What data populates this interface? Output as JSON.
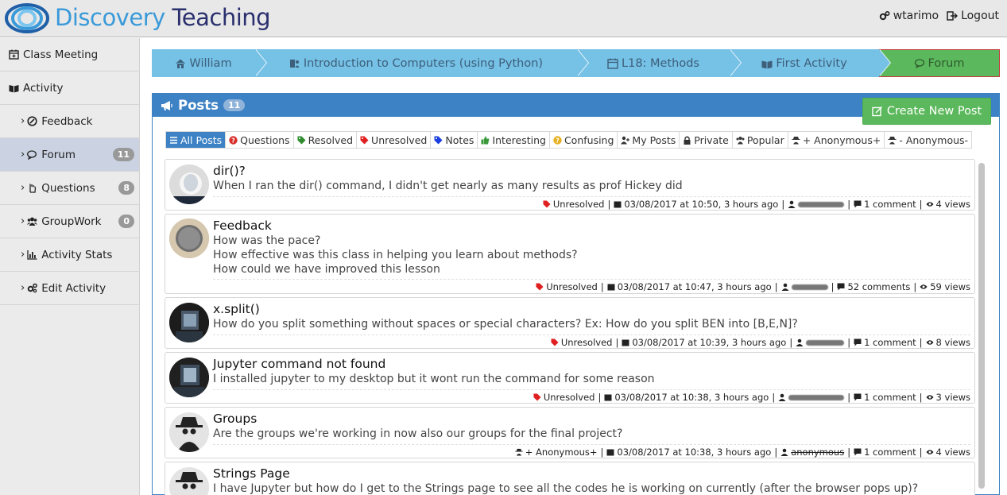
{
  "header": {
    "brand_part1": "Discovery",
    "brand_part2": "Teaching",
    "username": "wtarimo",
    "logout": "Logout"
  },
  "sidebar": {
    "items": [
      {
        "label": "Class Meeting",
        "icon": "calendar-icon",
        "badge": ""
      },
      {
        "label": "Activity",
        "icon": "book-icon",
        "badge": ""
      },
      {
        "label": "Feedback",
        "icon": "feedback-icon",
        "badge": ""
      },
      {
        "label": "Forum",
        "icon": "comments-icon",
        "badge": "11"
      },
      {
        "label": "Questions",
        "icon": "hand-icon",
        "badge": "8"
      },
      {
        "label": "GroupWork",
        "icon": "users-icon",
        "badge": "0"
      },
      {
        "label": "Activity Stats",
        "icon": "bar-chart-icon",
        "badge": ""
      },
      {
        "label": "Edit Activity",
        "icon": "cogs-icon",
        "badge": ""
      }
    ]
  },
  "breadcrumb": [
    {
      "label": "William",
      "icon": "home-icon"
    },
    {
      "label": "Introduction to Computers (using Python)",
      "icon": "courses-icon"
    },
    {
      "label": "L18: Methods",
      "icon": "calendar-icon"
    },
    {
      "label": "First Activity",
      "icon": "book-icon"
    },
    {
      "label": "Forum",
      "icon": "comments-icon"
    }
  ],
  "panel": {
    "title": "Posts",
    "count": "11",
    "new_post": "Create New Post"
  },
  "filters": [
    {
      "label": "All Posts",
      "icon": "list-icon",
      "color": "#ffffff"
    },
    {
      "label": "Questions",
      "icon": "question-icon",
      "color": "#d9302c"
    },
    {
      "label": "Resolved",
      "icon": "tag-icon",
      "color": "#2e8b2e"
    },
    {
      "label": "Unresolved",
      "icon": "tag-icon",
      "color": "#e02020"
    },
    {
      "label": "Notes",
      "icon": "tag-icon",
      "color": "#1a3ee0"
    },
    {
      "label": "Interesting",
      "icon": "thumbs-up-icon",
      "color": "#3a9a3a"
    },
    {
      "label": "Confusing",
      "icon": "question-icon",
      "color": "#e6b020"
    },
    {
      "label": "My Posts",
      "icon": "user-plus-icon",
      "color": "#333333"
    },
    {
      "label": "Private",
      "icon": "lock-icon",
      "color": "#333333"
    },
    {
      "label": "Popular",
      "icon": "users-icon",
      "color": "#333333"
    },
    {
      "label": "+ Anonymous+",
      "icon": "anon-icon",
      "color": "#333333"
    },
    {
      "label": "- Anonymous-",
      "icon": "anon-icon",
      "color": "#333333"
    }
  ],
  "posts": [
    {
      "title": "dir()?",
      "body": [
        "When I ran the dir() command, I didn't get nearly as many results as prof Hickey did"
      ],
      "status": "Unresolved",
      "date": "03/08/2017 at 10:50, 3 hours ago",
      "author": "",
      "comments": "1 comment",
      "views": "4 views",
      "avatar": "ghost-photo"
    },
    {
      "title": "Feedback",
      "body": [
        "How was the pace?",
        "How effective was this class in helping you learn about methods?",
        "How could we have improved this lesson"
      ],
      "status": "Unresolved",
      "date": "03/08/2017 at 10:47, 3 hours ago",
      "author": "",
      "comments": "52 comments",
      "views": "59 views",
      "avatar": "grey-photo"
    },
    {
      "title": "x.split()",
      "body": [
        "How do you split something without spaces or special characters? Ex: How do you split BEN into [B,E,N]?"
      ],
      "status": "Unresolved",
      "date": "03/08/2017 at 10:39, 3 hours ago",
      "author": "",
      "comments": "1 comment",
      "views": "8 views",
      "avatar": "dark-photo"
    },
    {
      "title": "Jupyter command not found",
      "body": [
        "I installed jupyter to my desktop but it wont run the command for some reason"
      ],
      "status": "Unresolved",
      "date": "03/08/2017 at 10:38, 3 hours ago",
      "author": "",
      "comments": "1 comment",
      "views": "3 views",
      "avatar": "dark-photo"
    },
    {
      "title": "Groups",
      "body": [
        "Are the groups we're working in now also our groups for the final project?"
      ],
      "status": "+ Anonymous+",
      "date": "03/08/2017 at 10:38, 3 hours ago",
      "author": "anonymous",
      "comments": "1 comment",
      "views": "4 views",
      "avatar": "anonymous-spy"
    },
    {
      "title": "Strings Page",
      "body": [
        "I have Jupyter but how do I get to the Strings page to see all the codes he is working on currently (after the browser pops up)?"
      ],
      "status": "",
      "date": "",
      "author": "",
      "comments": "",
      "views": "",
      "avatar": "anonymous-spy"
    }
  ]
}
